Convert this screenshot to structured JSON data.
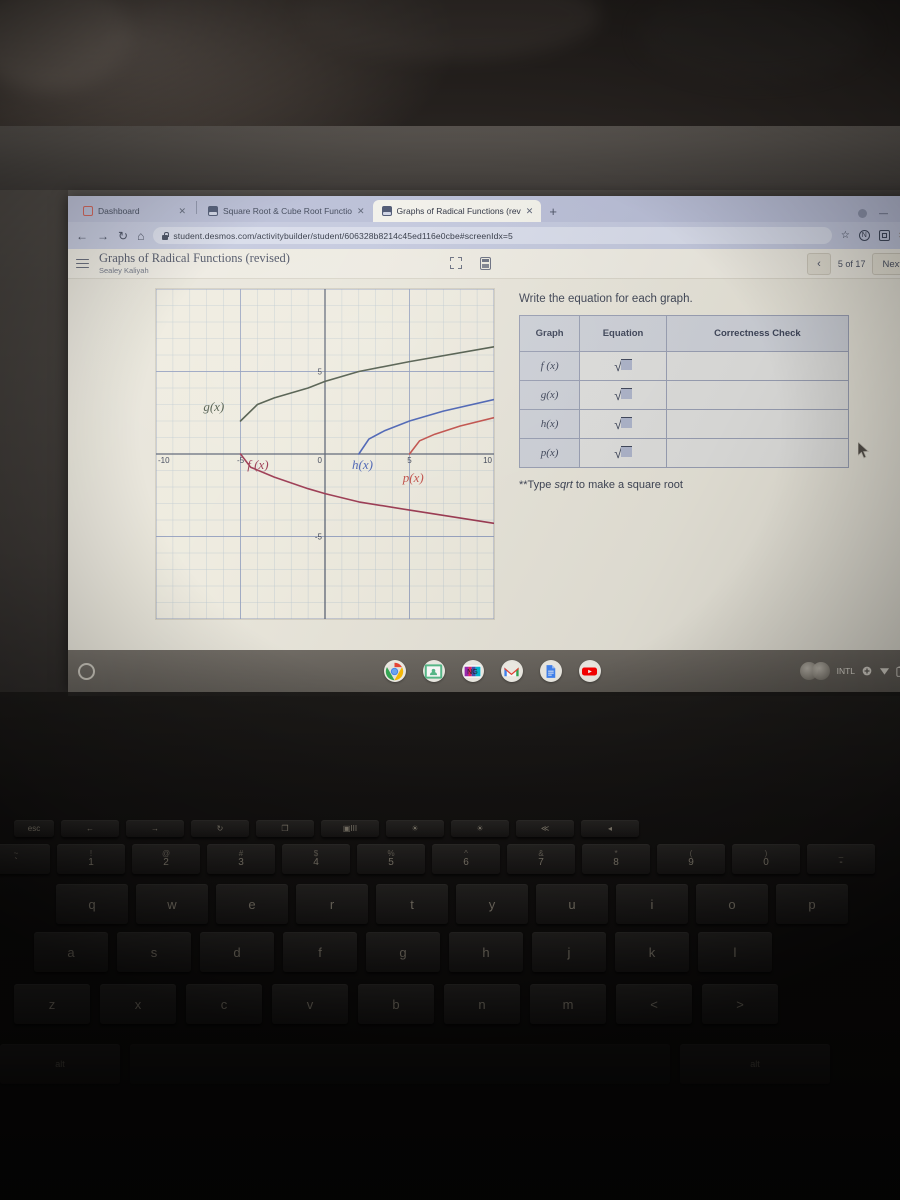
{
  "browser": {
    "tabs": [
      {
        "title": "Dashboard",
        "favicon": "dashboard-icon",
        "active": false,
        "close_label": "✕"
      },
      {
        "title": "Square Root & Cube Root Functio",
        "favicon": "desmos-icon",
        "active": false,
        "close_label": "✕"
      },
      {
        "title": "Graphs of Radical Functions (rev",
        "favicon": "desmos-icon",
        "active": true,
        "close_label": "✕"
      }
    ],
    "new_tab_label": "+",
    "nav": {
      "back": "←",
      "forward": "→",
      "reload": "↻",
      "home": "⌂"
    },
    "url": "student.desmos.com/activitybuilder/student/606328b8214c45ed116e0cbe#screenIdx=5",
    "toolbar_icons": [
      "bookmark-star-icon",
      "n-extension-icon",
      "reader-mode-icon",
      "extensions-puzzle-icon"
    ],
    "window_controls": [
      "profile-icon",
      "minimize-icon",
      "maximize-icon"
    ]
  },
  "app": {
    "menu_icon": "hamburger-menu-icon",
    "title": "Graphs of Radical Functions (revised)",
    "student": "Sealey Kaliyah",
    "tools": [
      "expand-icon",
      "calculator-icon"
    ],
    "pager": {
      "prev_label": "‹",
      "count_label": "5 of 17",
      "next_label": "Next"
    }
  },
  "activity": {
    "prompt": "Write the equation for each graph.",
    "note_prefix": "**Type ",
    "note_em": "sqrt",
    "note_suffix": " to make a square root",
    "table": {
      "headers": [
        "Graph",
        "Equation",
        "Correctness Check"
      ],
      "rows": [
        {
          "graph": "f (x)",
          "equation": "",
          "check": ""
        },
        {
          "graph": "g(x)",
          "equation": "",
          "check": ""
        },
        {
          "graph": "h(x)",
          "equation": "",
          "check": ""
        },
        {
          "graph": "p(x)",
          "equation": "",
          "check": ""
        }
      ],
      "radical_symbol": "√"
    }
  },
  "chart_data": {
    "type": "line",
    "title": "",
    "xlabel": "",
    "ylabel": "",
    "xlim": [
      -10,
      10
    ],
    "ylim": [
      -10,
      10
    ],
    "xticks": [
      -10,
      -5,
      0,
      5,
      10
    ],
    "yticks": [
      5,
      0,
      -5
    ],
    "grid": true,
    "grid_minor_step": 1,
    "grid_major_step": 5,
    "series": [
      {
        "name": "g(x)",
        "color": "#4f5a4a",
        "label": "g(x)",
        "label_x": -7.2,
        "label_y": 2.6,
        "description": "square root opening right, vertex at (-5, 2), increasing",
        "vertex": [
          -5,
          2
        ],
        "points": [
          [
            -5,
            2
          ],
          [
            -4,
            3
          ],
          [
            -3,
            3.4
          ],
          [
            -1,
            4.0
          ],
          [
            0,
            4.4
          ],
          [
            2,
            5.0
          ],
          [
            5,
            5.6
          ],
          [
            10,
            6.5
          ]
        ]
      },
      {
        "name": "f(x)",
        "color": "#9c3a52",
        "label": "f (x)",
        "label_x": -4.6,
        "label_y": -0.9,
        "description": "negative square root, vertex at (-5, 0), decreasing",
        "vertex": [
          -5,
          0
        ],
        "points": [
          [
            -5,
            0
          ],
          [
            -4.4,
            -0.8
          ],
          [
            -3,
            -1.4
          ],
          [
            -1,
            -2.1
          ],
          [
            0,
            -2.4
          ],
          [
            2,
            -2.9
          ],
          [
            5,
            -3.4
          ],
          [
            10,
            -4.2
          ]
        ]
      },
      {
        "name": "h(x)",
        "color": "#4a63b5",
        "label": "h(x)",
        "label_x": 1.6,
        "label_y": -0.9,
        "description": "square root opening right, vertex at (2, 0), increasing",
        "vertex": [
          2,
          0
        ],
        "points": [
          [
            2,
            0
          ],
          [
            2.6,
            0.9
          ],
          [
            3.5,
            1.4
          ],
          [
            5,
            2.0
          ],
          [
            7,
            2.6
          ],
          [
            10,
            3.3
          ]
        ]
      },
      {
        "name": "p(x)",
        "color": "#c3504a",
        "label": "p(x)",
        "label_x": 4.6,
        "label_y": -1.7,
        "description": "square root opening right, vertex at (5, 0), increasing",
        "vertex": [
          5,
          0
        ],
        "points": [
          [
            5,
            0
          ],
          [
            5.6,
            0.8
          ],
          [
            6.5,
            1.2
          ],
          [
            8,
            1.7
          ],
          [
            10,
            2.2
          ]
        ]
      }
    ]
  },
  "shelf": {
    "launcher_label": "launcher-circle-icon",
    "apps": [
      {
        "name": "chrome-icon",
        "label": ""
      },
      {
        "name": "google-classroom-icon",
        "label": ""
      },
      {
        "name": "nearpod-icon",
        "label": ""
      },
      {
        "name": "gmail-icon",
        "label": "M"
      },
      {
        "name": "google-docs-icon",
        "label": ""
      },
      {
        "name": "youtube-icon",
        "label": ""
      }
    ],
    "tray": {
      "input_method": "INTL",
      "icons": [
        "accessibility-icon",
        "wifi-icon",
        "battery-icon"
      ]
    }
  },
  "keyboard": {
    "fn_row": [
      "esc",
      "←",
      "→",
      "↻",
      "❐",
      "▣III",
      "☀",
      "☀",
      "≪",
      "◂"
    ],
    "num_row": [
      {
        "up": "~",
        "dn": "`"
      },
      {
        "up": "!",
        "dn": "1"
      },
      {
        "up": "@",
        "dn": "2"
      },
      {
        "up": "#",
        "dn": "3"
      },
      {
        "up": "$",
        "dn": "4"
      },
      {
        "up": "%",
        "dn": "5"
      },
      {
        "up": "^",
        "dn": "6"
      },
      {
        "up": "&",
        "dn": "7"
      },
      {
        "up": "*",
        "dn": "8"
      },
      {
        "up": "(",
        "dn": "9"
      },
      {
        "up": ")",
        "dn": "0"
      },
      {
        "up": "_",
        "dn": "-"
      }
    ],
    "row_q": [
      "q",
      "w",
      "e",
      "r",
      "t",
      "y",
      "u",
      "i",
      "o",
      "p"
    ],
    "row_a": [
      "a",
      "s",
      "d",
      "f",
      "g",
      "h",
      "j",
      "k",
      "l"
    ],
    "row_z": [
      "z",
      "x",
      "c",
      "v",
      "b",
      "n",
      "m",
      "<",
      ">"
    ],
    "bottom_row": [
      "alt",
      "",
      "alt"
    ]
  },
  "colors": {
    "tab_strip": "#b9bed6",
    "omnibar": "#c3c8dd",
    "page_bg": "#e8e5da",
    "shelf": "#5e5a54",
    "table_border": "#9aa0b4"
  }
}
